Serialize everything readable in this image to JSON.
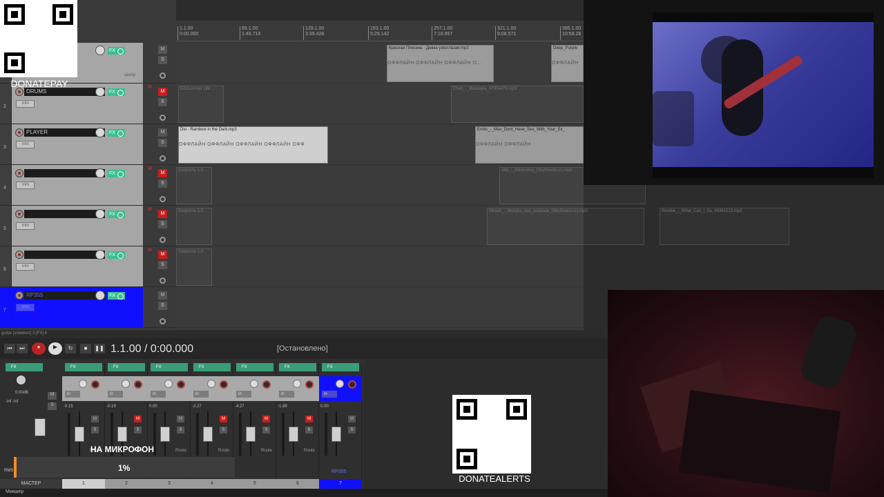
{
  "ruler": {
    "marks": [
      {
        "bar": "1.1.00",
        "time": "0:00.000"
      },
      {
        "bar": "65.1.00",
        "time": "1:49.714"
      },
      {
        "bar": "129.1.00",
        "time": "3:39.428"
      },
      {
        "bar": "193.1.00",
        "time": "5:29.142"
      },
      {
        "bar": "257.1.00",
        "time": "7:18.857"
      },
      {
        "bar": "321.1.00",
        "time": "9:08.571"
      },
      {
        "bar": "385.1.00",
        "time": "10:58.28"
      }
    ]
  },
  "master_track": {
    "pan_label": "центр"
  },
  "tracks": [
    {
      "num": "2",
      "name": "DRUMS",
      "trim": "trim"
    },
    {
      "num": "3",
      "name": "PLAYER",
      "trim": "trim"
    },
    {
      "num": "4",
      "name": "",
      "trim": "trim"
    },
    {
      "num": "5",
      "name": "",
      "trim": "trim"
    },
    {
      "num": "6",
      "name": "",
      "trim": "trim"
    },
    {
      "num": "7",
      "name": "RP355",
      "trim": "trim"
    }
  ],
  "buttons": {
    "m": "M",
    "s": "S",
    "fx": "FX"
  },
  "items": {
    "lane1a": {
      "name": "Красная Плесень - Девка узкоглазая.mp3",
      "wave": "ОФФЛАЙН   ОФФЛАЙН   ОФФЛАЙН   О..."
    },
    "lane1b": {
      "name": "Deep_Purple",
      "wave": "ОФФЛАЙН"
    },
    "lane2a": {
      "name": "EZdrummer Libr..."
    },
    "lane2b": {
      "name": "Zhuki_-_Batarejka_47954478.mp3"
    },
    "lane3a": {
      "name": "Dio - Rainbow in the Dark.mp3",
      "wave": "ОФФЛАЙН   ОФФЛАЙН   ОФФЛАЙН   ОФФЛАЙН   ОФФ"
    },
    "lane3b": {
      "name": "Erotic_-_Max_Dont_Have_Sex_With_Your_Ex_",
      "wave": "ОФФЛАЙН   ОФФЛАЙН"
    },
    "lane4a": {
      "name": "Скорость:1.0..."
    },
    "lane4b": {
      "name": "Alfa_-_Zdravstvuj_(SkySound.cc).mp3"
    },
    "lane5a": {
      "name": "Скорость:1.0..."
    },
    "lane5b": {
      "name": "Mirash_-_Muzyka_nas_svyazala_(SkySound.cc).mp3"
    },
    "lane5c": {
      "name": "Smokie_-_What_Can_I_Do_40361513.mp3"
    },
    "lane6a": {
      "name": "Скорость:1.0..."
    }
  },
  "statusline": "guitar [элемент] 3 [FX] 6",
  "transport": {
    "position": "1.1.00 / 0:00.000",
    "state": "[Остановлено]"
  },
  "mixer": {
    "master": {
      "vol": "0.00dB",
      "meters": "-inf -inf",
      "label": "МАСТЕР",
      "rms": "RMS"
    },
    "channels": [
      {
        "num": "1",
        "vol": "-0.15",
        "m_on": false
      },
      {
        "num": "2",
        "vol": "-0.19",
        "m_on": true
      },
      {
        "num": "3",
        "vol": "0.00",
        "m_on": false
      },
      {
        "num": "4",
        "vol": "-2.27",
        "m_on": true
      },
      {
        "num": "5",
        "vol": "-4.27",
        "m_on": true
      },
      {
        "num": "6",
        "vol": "-1.89",
        "m_on": true
      },
      {
        "num": "7",
        "vol": "0.00",
        "m_on": false,
        "name": "RP355"
      }
    ],
    "in_label": "in",
    "route_label": "Route"
  },
  "overlay": {
    "mic_text": "НА МИКРОФОН",
    "mic_percent": "1%",
    "mic_progress": 0.01,
    "donatepay": "DONATEPAY",
    "donatealerts": "DONATEALERTS"
  },
  "bottom": {
    "tab": "Микшер"
  },
  "colors": {
    "selected": "#1010ff",
    "fx": "#3bbf8f",
    "mute": "#c81e1e"
  }
}
